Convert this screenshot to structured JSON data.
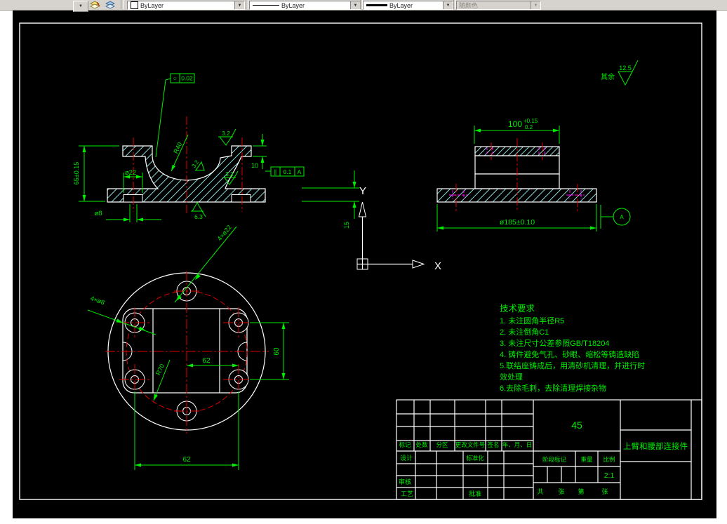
{
  "toolbar": {
    "color_combo": {
      "value": "ByLayer"
    },
    "linetype_combo": {
      "value": "ByLayer"
    },
    "lineweight_combo": {
      "value": "ByLayer"
    },
    "plotstyle_combo": {
      "value": "随颜色"
    }
  },
  "drawing": {
    "surface_default": {
      "prefix": "其余",
      "roughness": "12.5"
    },
    "front_view": {
      "fcf_top": {
        "symbol": "○",
        "tolerance": "0.02"
      },
      "fcf_side": {
        "symbol": "∥",
        "tolerance": "0.1",
        "datum": "A"
      },
      "dims": {
        "height": "65±0.15",
        "bore": "ø22",
        "hole": "ø8",
        "flange_thk": "10",
        "radius": "R40",
        "base_thk": "15"
      },
      "roughness": {
        "top": "3.2",
        "slope": "3.2",
        "wall": "3.2",
        "bottom": "6.3"
      }
    },
    "side_view": {
      "dims": {
        "width": "100",
        "width_tol_upper": "+0.15",
        "width_tol_lower": "0.2",
        "diameter": "ø185±0.10"
      },
      "datum_label": "A"
    },
    "plan_view": {
      "leaders": {
        "bosses": "4×ø22",
        "holes": "4×ø8",
        "bolt_circle": "R70"
      },
      "dims": {
        "spacing_half": "62",
        "spacing_v": "60",
        "spacing_h": "62"
      }
    },
    "ucs": {
      "x_label": "X",
      "y_label": "Y"
    },
    "tech_requirements": {
      "title": "技术要求",
      "lines": [
        "1.  未注圆角半径R5",
        "2.  未注倒角C1",
        "3. 未注尺寸公差参照GB/T18204",
        "4.  铸件避免气孔、砂眼、缩松等铸造缺陷",
        "5.联结座铸成后，用清砂机清理，并进行时",
        "效处理",
        "6.去除毛刺，去除清理焊接杂物"
      ]
    }
  },
  "title_block": {
    "material": "45",
    "part_name": "上臂和腰部连接件",
    "scale_value": "2:1",
    "labels": {
      "mark": "标记",
      "count": "处数",
      "zone": "分区",
      "doc_no": "更改文件号",
      "signature": "签名",
      "date": "年、月、日",
      "design": "设计",
      "standardization": "标准化",
      "check": "审核",
      "process": "工艺",
      "approve": "批准",
      "stage_mark": "阶段标记",
      "weight": "重量",
      "scale": "比例",
      "total": "共",
      "sheets": "张",
      "sheet_no": "第",
      "sheet": "张"
    }
  }
}
